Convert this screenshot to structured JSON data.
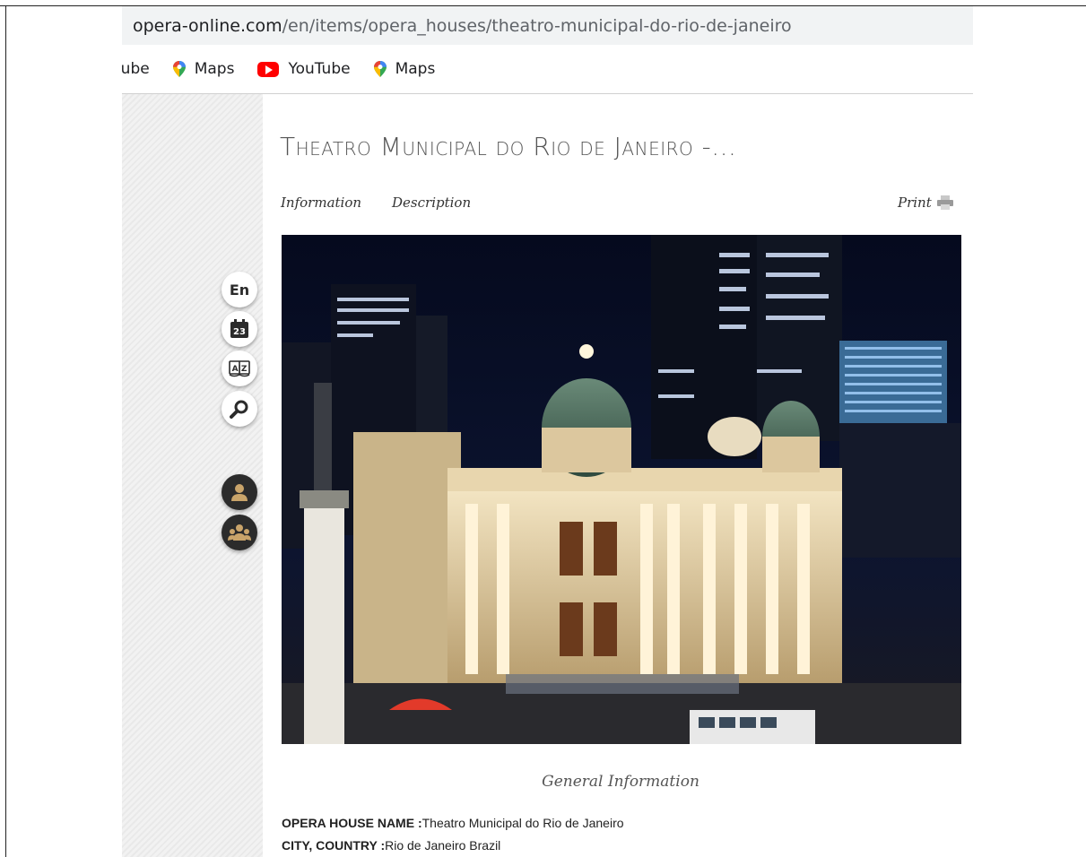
{
  "browser": {
    "url_host": "opera-online.com",
    "url_path": "/en/items/opera_houses/theatro-municipal-do-rio-de-janeiro",
    "bookmarks": [
      {
        "label": "'ube",
        "icon": "youtube-icon"
      },
      {
        "label": "Maps",
        "icon": "maps-icon"
      },
      {
        "label": "YouTube",
        "icon": "youtube-icon"
      },
      {
        "label": "Maps",
        "icon": "maps-icon"
      }
    ]
  },
  "page": {
    "title": "Theatro Municipal do Rio de Janeiro -...",
    "tabs": [
      "Information",
      "Description"
    ],
    "print_label": "Print",
    "section_title": "General Information",
    "info": [
      {
        "label": "OPERA HOUSE NAME :",
        "value": "Theatro Municipal do Rio de Janeiro"
      },
      {
        "label": "CITY, COUNTRY :",
        "value": "Rio de Janeiro Brazil"
      }
    ]
  },
  "tools": {
    "language": "En",
    "calendar_day": "23",
    "dictionary": "A|Z"
  }
}
